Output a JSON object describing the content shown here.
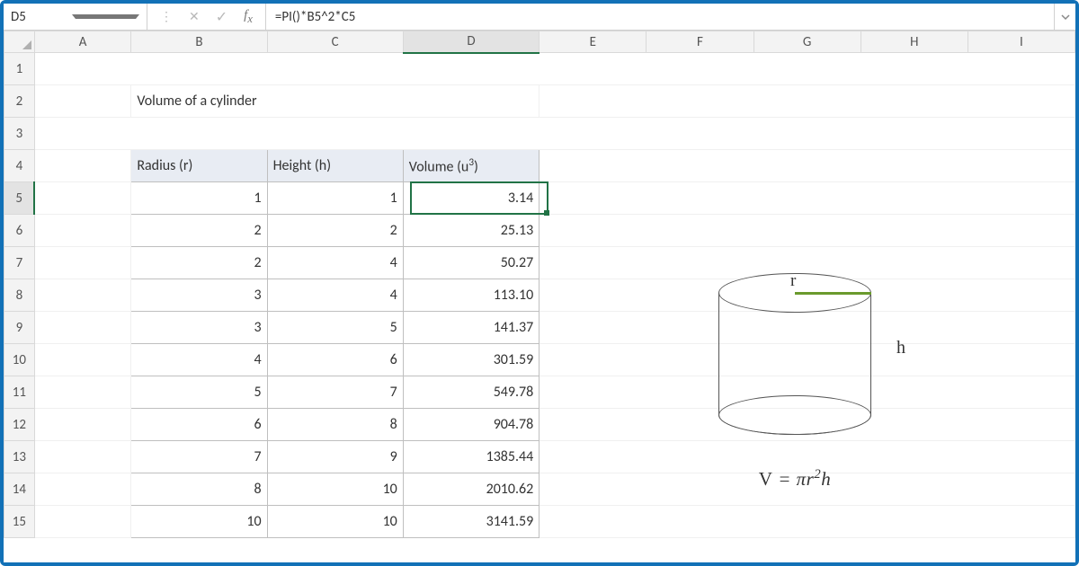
{
  "namebox": "D5",
  "formula": "=PI()*B5^2*C5",
  "title": "Volume of a cylinder",
  "columns": [
    "A",
    "B",
    "C",
    "D",
    "E",
    "F",
    "G",
    "H",
    "I"
  ],
  "rows": [
    "1",
    "2",
    "3",
    "4",
    "5",
    "6",
    "7",
    "8",
    "9",
    "10",
    "11",
    "12",
    "13",
    "14",
    "15"
  ],
  "headers": {
    "radius": "Radius (r)",
    "height": "Height (h)",
    "volume_prefix": "Volume (u",
    "volume_exp": "3",
    "volume_suffix": ")"
  },
  "data": [
    {
      "r": "1",
      "h": "1",
      "v": "3.14"
    },
    {
      "r": "2",
      "h": "2",
      "v": "25.13"
    },
    {
      "r": "2",
      "h": "4",
      "v": "50.27"
    },
    {
      "r": "3",
      "h": "4",
      "v": "113.10"
    },
    {
      "r": "3",
      "h": "5",
      "v": "141.37"
    },
    {
      "r": "4",
      "h": "6",
      "v": "301.59"
    },
    {
      "r": "5",
      "h": "7",
      "v": "549.78"
    },
    {
      "r": "6",
      "h": "8",
      "v": "904.78"
    },
    {
      "r": "7",
      "h": "9",
      "v": "1385.44"
    },
    {
      "r": "8",
      "h": "10",
      "v": "2010.62"
    },
    {
      "r": "10",
      "h": "10",
      "v": "3141.59"
    }
  ],
  "diagram": {
    "r_label": "r",
    "h_label": "h",
    "formula": "V = πr²h"
  },
  "active_cell_row": 5,
  "active_cell_col": "D"
}
